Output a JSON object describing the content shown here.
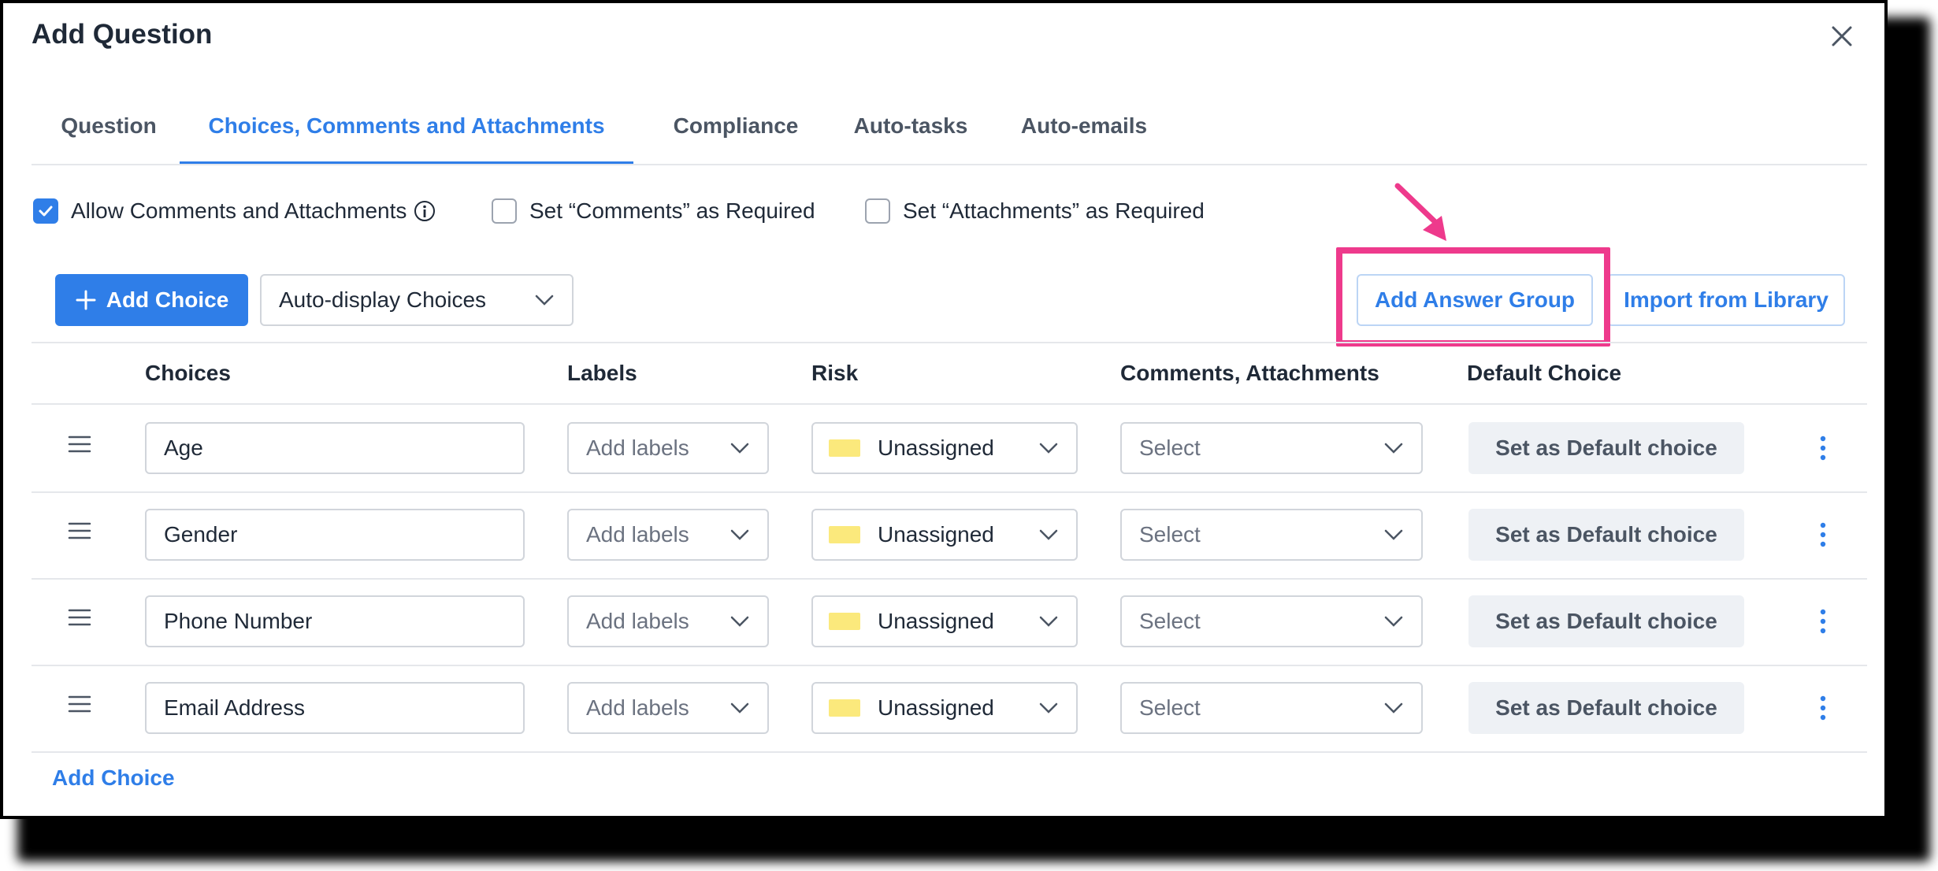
{
  "dialog": {
    "title": "Add Question"
  },
  "tabs": [
    {
      "label": "Question",
      "active": false
    },
    {
      "label": "Choices, Comments and Attachments",
      "active": true
    },
    {
      "label": "Compliance",
      "active": false
    },
    {
      "label": "Auto-tasks",
      "active": false
    },
    {
      "label": "Auto-emails",
      "active": false
    }
  ],
  "options": {
    "allow_comments_label": "Allow Comments and Attachments",
    "allow_comments_checked": true,
    "comments_required_label": "Set “Comments” as Required",
    "comments_required_checked": false,
    "attachments_required_label": "Set “Attachments” as Required",
    "attachments_required_checked": false
  },
  "toolbar": {
    "add_choice_label": "Add Choice",
    "auto_display_label": "Auto-display Choices",
    "add_answer_group_label": "Add Answer Group",
    "import_library_label": "Import from Library"
  },
  "table": {
    "headers": [
      "Choices",
      "Labels",
      "Risk",
      "Comments, Attachments",
      "Default Choice"
    ],
    "rows": [
      {
        "choice": "Age",
        "labels_placeholder": "Add labels",
        "risk": "Unassigned",
        "comments": "Select",
        "default_label": "Set as Default choice"
      },
      {
        "choice": "Gender",
        "labels_placeholder": "Add labels",
        "risk": "Unassigned",
        "comments": "Select",
        "default_label": "Set as Default choice"
      },
      {
        "choice": "Phone Number",
        "labels_placeholder": "Add labels",
        "risk": "Unassigned",
        "comments": "Select",
        "default_label": "Set as Default choice"
      },
      {
        "choice": "Email Address",
        "labels_placeholder": "Add labels",
        "risk": "Unassigned",
        "comments": "Select",
        "default_label": "Set as Default choice"
      }
    ]
  },
  "footer": {
    "add_choice_link": "Add Choice"
  },
  "colors": {
    "accent": "#2f7ee8",
    "highlight": "#ee3a8c",
    "risk_unassigned": "#fbe97c"
  }
}
